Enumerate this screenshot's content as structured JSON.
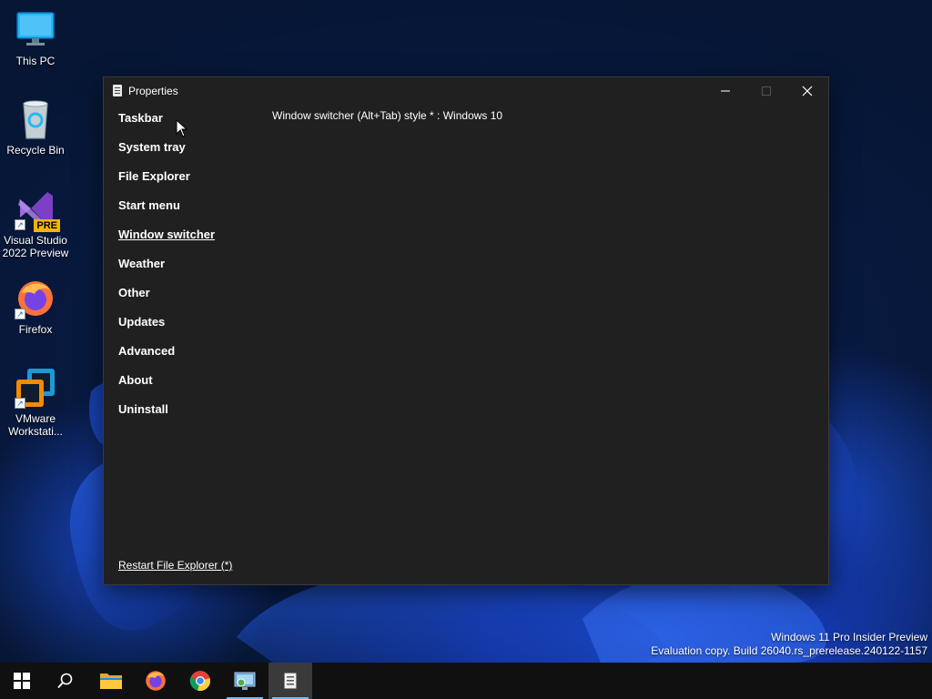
{
  "desktop": {
    "icons": [
      {
        "label": "This PC",
        "icon": "monitor-icon"
      },
      {
        "label": "Recycle Bin",
        "icon": "recycle-bin-icon"
      },
      {
        "label": "Visual Studio 2022 Preview",
        "icon": "visual-studio-icon",
        "badge": "PRE"
      },
      {
        "label": "Firefox",
        "icon": "firefox-icon"
      },
      {
        "label": "VMware Workstati...",
        "icon": "vmware-icon"
      }
    ]
  },
  "window": {
    "title": "Properties",
    "nav": [
      "Taskbar",
      "System tray",
      "File Explorer",
      "Start menu",
      "Window switcher",
      "Weather",
      "Other",
      "Updates",
      "Advanced",
      "About",
      "Uninstall"
    ],
    "active_nav": "Window switcher",
    "setting_text": "Window switcher (Alt+Tab) style * : Windows 10",
    "restart_link": "Restart File Explorer (*)"
  },
  "watermark": {
    "line1": "Windows 11 Pro Insider Preview",
    "line2": "Evaluation copy. Build 26040.rs_prerelease.240122-1157"
  },
  "taskbar": {
    "items": [
      "start-icon",
      "search-icon",
      "file-explorer-icon",
      "firefox-icon",
      "chrome-icon",
      "control-panel-icon",
      "properties-app-icon"
    ]
  },
  "colors": {
    "window_bg": "#202020",
    "taskbar_bg": "#101010",
    "accent": "#76b9ed"
  }
}
